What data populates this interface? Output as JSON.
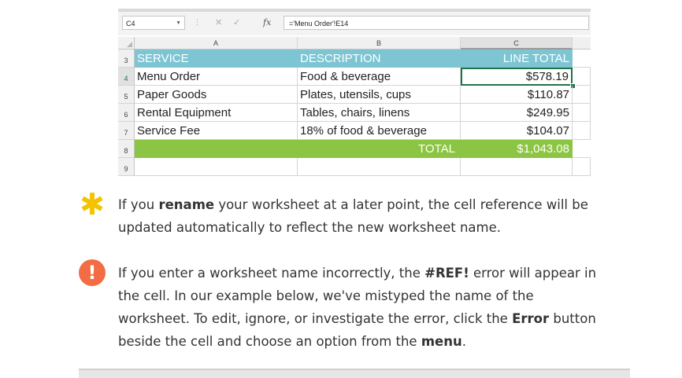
{
  "formula_bar": {
    "name_box": "C4",
    "formula": "='Menu Order'!E14",
    "fx_label": "fx"
  },
  "columns": [
    "A",
    "B",
    "C"
  ],
  "rows": [
    {
      "num": "3",
      "a": "SERVICE",
      "b": "DESCRIPTION",
      "c": "LINE TOTAL"
    },
    {
      "num": "4",
      "a": "Menu Order",
      "b": "Food & beverage",
      "c": "$578.19"
    },
    {
      "num": "5",
      "a": "Paper Goods",
      "b": "Plates, utensils, cups",
      "c": "$110.87"
    },
    {
      "num": "6",
      "a": "Rental Equipment",
      "b": "Tables, chairs, linens",
      "c": "$249.95"
    },
    {
      "num": "7",
      "a": "Service Fee",
      "b": "18% of food & beverage",
      "c": "$104.07"
    },
    {
      "num": "8",
      "ab": "TOTAL",
      "c": "$1,043.08"
    },
    {
      "num": "9",
      "a": "",
      "b": "",
      "c": ""
    }
  ],
  "tips": {
    "rename": {
      "pre": "If you ",
      "bold1": "rename",
      "post": " your worksheet at a later point, the cell reference will be updated automatically to reflect the new worksheet name."
    },
    "ref_error": {
      "p1": "If you enter a worksheet name incorrectly, the ",
      "b1": "#REF!",
      "p2": " error will appear in the cell. In our example below, we've mistyped the name of the worksheet. To edit, ignore, or investigate the error, click the ",
      "b2": "Error",
      "p3": " button beside the cell and choose an option from the ",
      "b3": "menu",
      "p4": "."
    }
  },
  "icons": {
    "star": "asterisk-icon",
    "warning": "exclamation-icon",
    "star_glyph": "✱",
    "warning_glyph": "!"
  },
  "colors": {
    "header_teal": "#7ec5d3",
    "total_green": "#8cc443",
    "star_yellow": "#f2c300",
    "warning_orange": "#f26d45"
  }
}
